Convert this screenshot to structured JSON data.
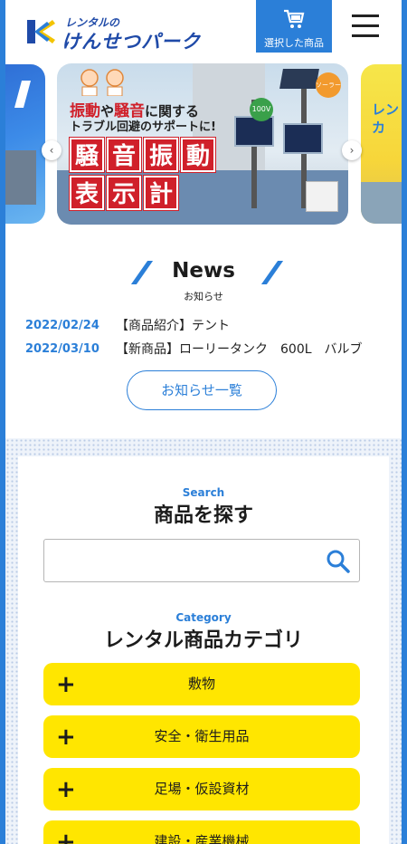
{
  "header": {
    "logo_small": "レンタルの",
    "logo_big": "けんせつパーク",
    "cart_label": "選択した商品"
  },
  "carousel": {
    "main_slide": {
      "headline_parts": [
        "振動",
        "や",
        "騒音",
        "に関する"
      ],
      "subline": "トラブル回避のサポートに!",
      "big_row1": [
        "騒",
        "音",
        "振",
        "動"
      ],
      "big_row2": [
        "表",
        "示",
        "計"
      ],
      "tag_power": "100V",
      "tag_solar": "ソーラー"
    },
    "right_slide_text": "レン\nカ",
    "prev_icon": "‹",
    "next_icon": "›"
  },
  "news": {
    "title": "News",
    "subtitle": "お知らせ",
    "items": [
      {
        "date": "2022/02/24",
        "text": "【商品紹介】テント"
      },
      {
        "date": "2022/03/10",
        "text": "【新商品】ローリータンク　600L　バルブ"
      }
    ],
    "more_label": "お知らせ一覧"
  },
  "search": {
    "heading_en": "Search",
    "heading_jp": "商品を探す",
    "input_value": "",
    "input_placeholder": ""
  },
  "category": {
    "heading_en": "Category",
    "heading_jp": "レンタル商品カテゴリ",
    "items": [
      {
        "label": "敷物"
      },
      {
        "label": "安全・衛生用品"
      },
      {
        "label": "足場・仮設資材"
      },
      {
        "label": "建設・産業機械"
      }
    ]
  },
  "colors": {
    "accent_blue": "#2b7fd8",
    "category_yellow": "#ffe600",
    "alert_red": "#d0202a"
  }
}
